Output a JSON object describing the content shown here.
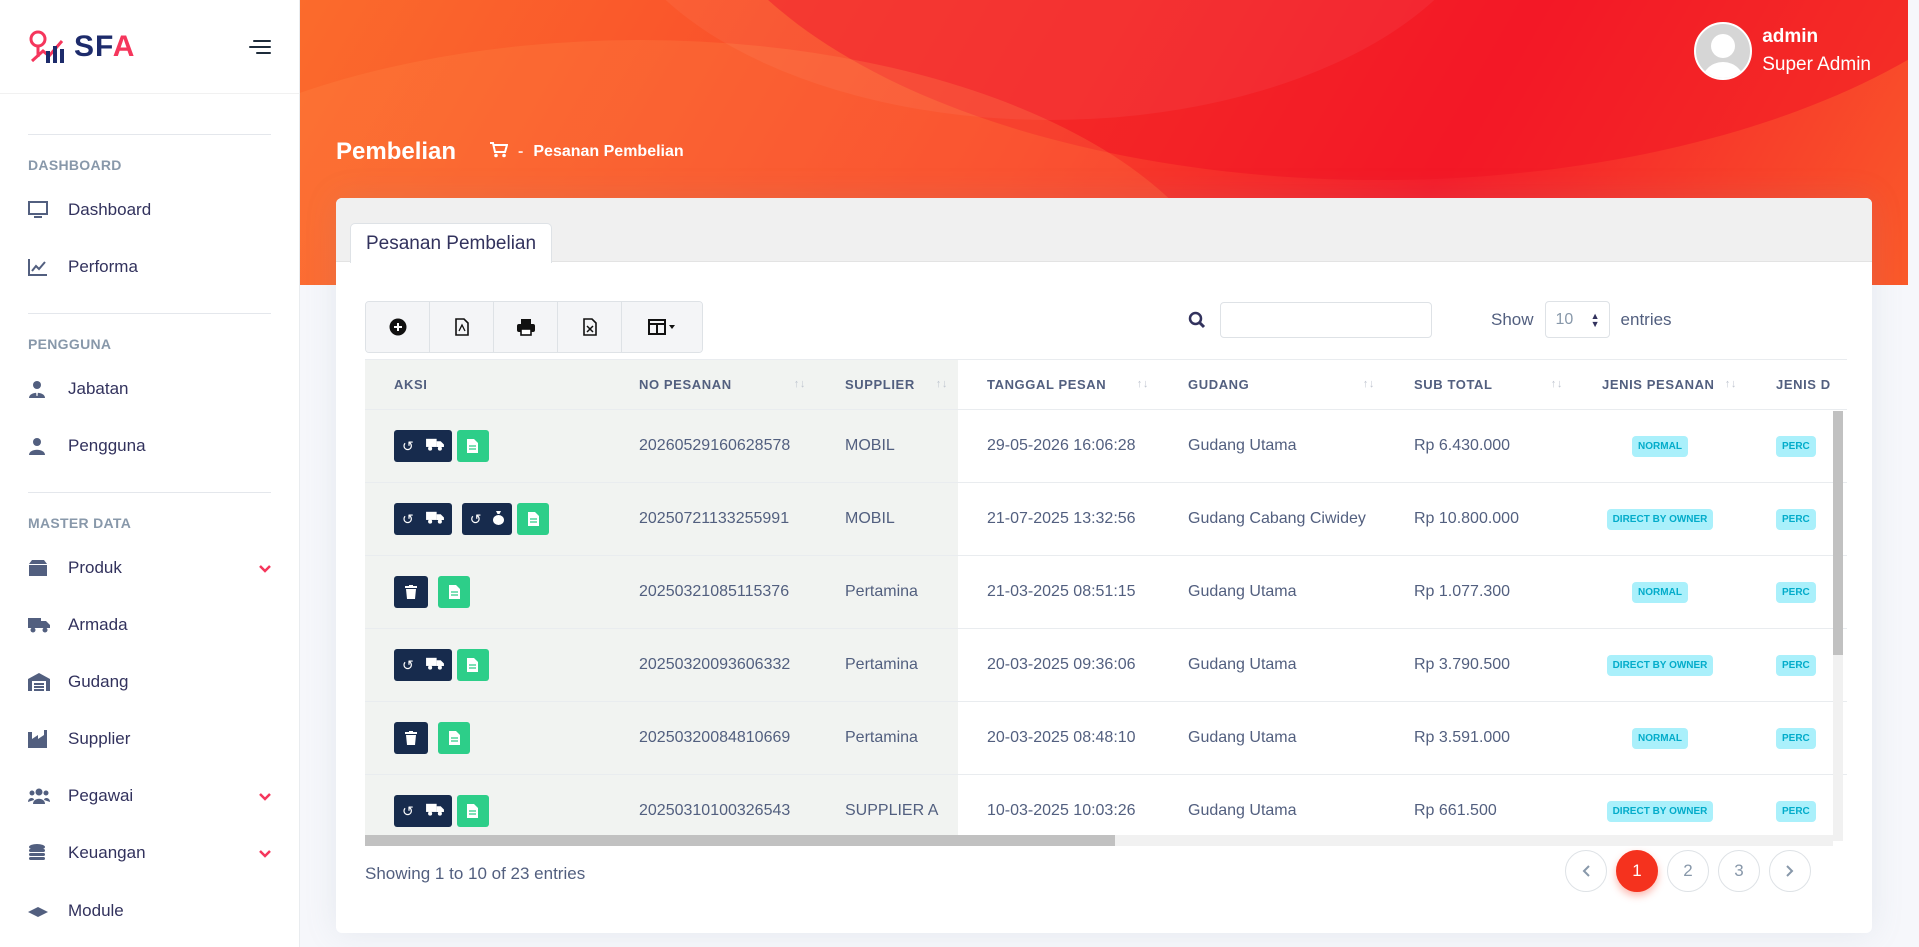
{
  "brand": {
    "name_main": "SF",
    "name_accent": "A"
  },
  "sidebar": {
    "sections": [
      {
        "title": "DASHBOARD",
        "items": [
          {
            "label": "Dashboard",
            "icon": "monitor-icon"
          },
          {
            "label": "Performa",
            "icon": "chart-line-icon"
          }
        ]
      },
      {
        "title": "PENGGUNA",
        "items": [
          {
            "label": "Jabatan",
            "icon": "user-tie-icon"
          },
          {
            "label": "Pengguna",
            "icon": "user-icon"
          }
        ]
      },
      {
        "title": "MASTER DATA",
        "items": [
          {
            "label": "Produk",
            "icon": "box-icon",
            "expandable": true
          },
          {
            "label": "Armada",
            "icon": "truck-icon"
          },
          {
            "label": "Gudang",
            "icon": "warehouse-icon"
          },
          {
            "label": "Supplier",
            "icon": "industry-icon"
          },
          {
            "label": "Pegawai",
            "icon": "users-icon",
            "expandable": true
          },
          {
            "label": "Keuangan",
            "icon": "coins-icon",
            "expandable": true
          },
          {
            "label": "Module",
            "icon": "graduation-cap-icon"
          }
        ]
      }
    ]
  },
  "user": {
    "name": "admin",
    "role": "Super Admin"
  },
  "header": {
    "title": "Pembelian",
    "breadcrumb": "Pesanan Pembelian",
    "breadcrumb_sep": "-"
  },
  "card": {
    "tab_label": "Pesanan Pembelian"
  },
  "search": {
    "placeholder": ""
  },
  "length": {
    "show_label": "Show",
    "value": "10",
    "entries_label": "entries"
  },
  "table": {
    "columns": [
      "AKSI",
      "NO PESANAN",
      "SUPPLIER",
      "TANGGAL PESAN",
      "GUDANG",
      "SUB TOTAL",
      "JENIS PESANAN",
      "JENIS D"
    ],
    "rows": [
      {
        "no": "20260529160628578",
        "supplier": "MOBIL",
        "tanggal": "29-05-2026 16:06:28",
        "gudang": "Gudang Utama",
        "subtotal": "Rp 6.430.000",
        "jenis": "NORMAL",
        "jenis_d": "PERC"
      },
      {
        "no": "20250721133255991",
        "supplier": "MOBIL",
        "tanggal": "21-07-2025 13:32:56",
        "gudang": "Gudang Cabang Ciwidey",
        "subtotal": "Rp 10.800.000",
        "jenis": "DIRECT BY OWNER",
        "jenis_d": "PERC"
      },
      {
        "no": "20250321085115376",
        "supplier": "Pertamina",
        "tanggal": "21-03-2025 08:51:15",
        "gudang": "Gudang Utama",
        "subtotal": "Rp 1.077.300",
        "jenis": "NORMAL",
        "jenis_d": "PERC"
      },
      {
        "no": "20250320093606332",
        "supplier": "Pertamina",
        "tanggal": "20-03-2025 09:36:06",
        "gudang": "Gudang Utama",
        "subtotal": "Rp 3.790.500",
        "jenis": "DIRECT BY OWNER",
        "jenis_d": "PERC"
      },
      {
        "no": "20250320084810669",
        "supplier": "Pertamina",
        "tanggal": "20-03-2025 08:48:10",
        "gudang": "Gudang Utama",
        "subtotal": "Rp 3.591.000",
        "jenis": "NORMAL",
        "jenis_d": "PERC"
      },
      {
        "no": "20250310100326543",
        "supplier": "SUPPLIER A",
        "tanggal": "10-03-2025 10:03:26",
        "gudang": "Gudang Utama",
        "subtotal": "Rp 661.500",
        "jenis": "DIRECT BY OWNER",
        "jenis_d": "PERC"
      }
    ]
  },
  "footer": {
    "info": "Showing 1 to 10 of 23 entries",
    "pages": [
      "1",
      "2",
      "3"
    ],
    "active_page": "1"
  },
  "colors": {
    "accent": "#f5321e",
    "dark_button": "#172b4d",
    "green_button": "#2dce89",
    "badge_bg": "#aaf0fb",
    "badge_text": "#03acca"
  }
}
